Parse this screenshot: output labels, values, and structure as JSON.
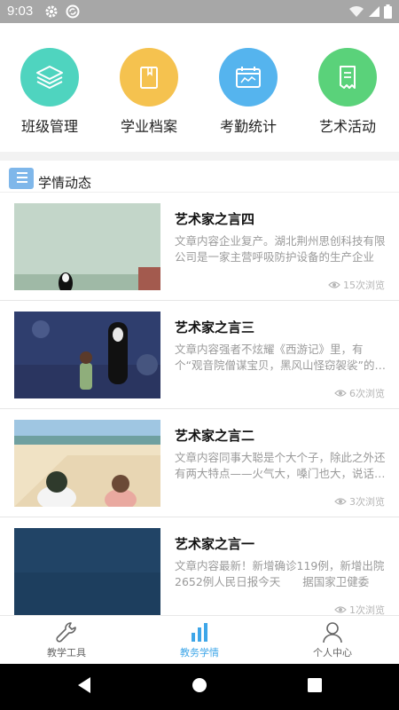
{
  "status_bar": {
    "time": "9:03",
    "left_icons": [
      "gear-icon",
      "sync-icon"
    ],
    "right_icons": [
      "wifi-icon",
      "signal-icon",
      "battery-icon"
    ]
  },
  "quick_actions": [
    {
      "label": "班级管理",
      "icon": "layers-icon",
      "color": "#4fd4bf"
    },
    {
      "label": "学业档案",
      "icon": "folder-icon",
      "color": "#f5c24f"
    },
    {
      "label": "考勤统计",
      "icon": "calendar-icon",
      "color": "#55b4ee"
    },
    {
      "label": "艺术活动",
      "icon": "receipt-icon",
      "color": "#5ad27a"
    }
  ],
  "news_section": {
    "title": "学情动态"
  },
  "articles": [
    {
      "title": "艺术家之言四",
      "summary": "文章内容企业复产。湖北荆州思创科技有限公司是一家主营呼吸防护设备的生产企业",
      "views": "15次浏览"
    },
    {
      "title": "艺术家之言三",
      "summary": "文章内容强者不炫耀《西游记》里，有个“观音院僧谋宝贝，黑风山怪窃袈裟”的故事",
      "views": "6次浏览"
    },
    {
      "title": "艺术家之言二",
      "summary": "文章内容同事大聪是个大个子，除此之外还有两大特点——火气大，嗓门也大，说话像吵架",
      "views": "3次浏览"
    },
    {
      "title": "艺术家之言一",
      "summary": "文章内容最新！新增确诊119例，新增出院2652例人民日报今天　　据国家卫健委",
      "views": "1次浏览"
    }
  ],
  "tab_bar": {
    "tabs": [
      {
        "label": "教学工具",
        "icon": "wrench-icon",
        "active": false
      },
      {
        "label": "教务学情",
        "icon": "bar-chart-icon",
        "active": true
      },
      {
        "label": "个人中心",
        "icon": "person-icon",
        "active": false
      }
    ]
  },
  "colors": {
    "accent": "#3ea6e8",
    "status_bar": "#a7a7a7",
    "nav_bar": "#000000"
  }
}
